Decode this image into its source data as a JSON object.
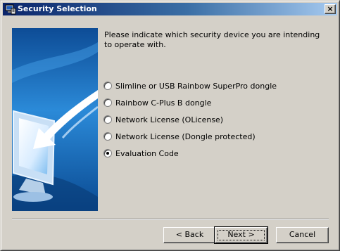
{
  "window": {
    "title": "Security Selection",
    "close_label": "×"
  },
  "prompt": "Please indicate which security device you are intending to operate with.",
  "options": [
    {
      "label": "Slimline or USB Rainbow SuperPro dongle",
      "selected": false
    },
    {
      "label": "Rainbow C-Plus B dongle",
      "selected": false
    },
    {
      "label": "Network License (OLicense)",
      "selected": false
    },
    {
      "label": "Network License (Dongle protected)",
      "selected": false
    },
    {
      "label": "Evaluation Code",
      "selected": true
    }
  ],
  "buttons": {
    "back": "< Back",
    "next": "Next >",
    "cancel": "Cancel"
  },
  "icons": {
    "title": "app-icon",
    "banner": "monitor-arrow-icon"
  },
  "colors": {
    "title_bar_start": "#0a246a",
    "title_bar_end": "#a6caf0",
    "face": "#d4d0c8",
    "banner_blue": "#1a6fc4"
  }
}
